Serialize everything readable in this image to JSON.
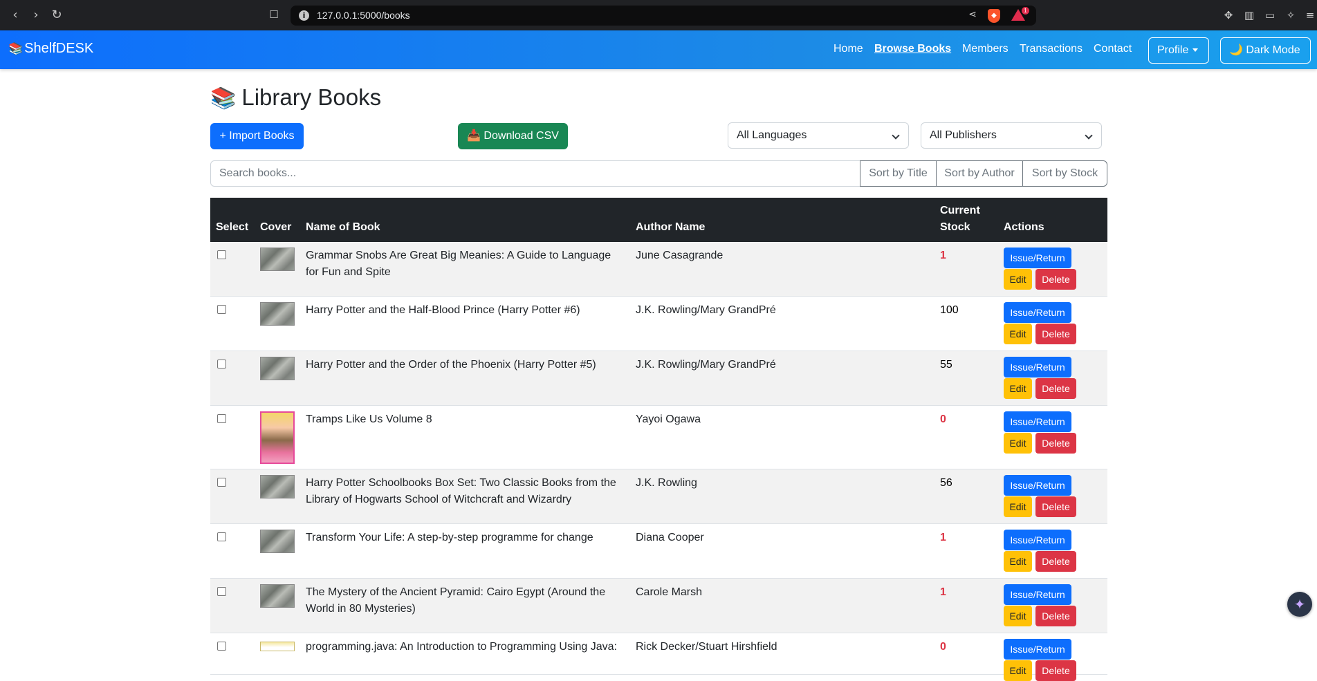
{
  "browser": {
    "url": "127.0.0.1:5000/books",
    "icons": [
      "back-icon",
      "forward-icon",
      "reload-icon",
      "bookmark-icon",
      "info-icon",
      "share-icon",
      "brave-shield-icon",
      "brave-rewards-icon",
      "extensions-icon",
      "sidebar-icon",
      "wallet-icon",
      "leo-icon",
      "menu-icon"
    ],
    "rewards_badge": "1"
  },
  "navbar": {
    "brand": "ShelfDESK",
    "brand_icon": "📚",
    "links": [
      "Home",
      "Browse Books",
      "Members",
      "Transactions",
      "Contact"
    ],
    "active_link": "Browse Books",
    "profile_label": "Profile",
    "dark_mode_label": "🌙 Dark Mode"
  },
  "page": {
    "title": "Library Books",
    "title_icon": "📚",
    "import_label": "+ Import Books",
    "download_label": "📥 Download CSV",
    "language_filter": "All Languages",
    "publisher_filter": "All Publishers",
    "search_placeholder": "Search books...",
    "sort_buttons": [
      "Sort by Title",
      "Sort by Author",
      "Sort by Stock"
    ]
  },
  "table": {
    "headers": {
      "select": "Select",
      "cover": "Cover",
      "name": "Name of Book",
      "author": "Author Name",
      "stock_line1": "Current",
      "stock_line2": "Stock",
      "actions": "Actions"
    },
    "action_labels": {
      "issue": "Issue/Return",
      "edit": "Edit",
      "delete": "Delete"
    },
    "rows": [
      {
        "title": "Grammar Snobs Are Great Big Meanies: A Guide to Language for Fun and Spite",
        "author": "June Casagrande",
        "stock": "1",
        "low": true,
        "cover": "generic"
      },
      {
        "title": "Harry Potter and the Half-Blood Prince (Harry Potter #6)",
        "author": "J.K. Rowling/Mary GrandPré",
        "stock": "100",
        "low": false,
        "cover": "generic"
      },
      {
        "title": "Harry Potter and the Order of the Phoenix (Harry Potter #5)",
        "author": "J.K. Rowling/Mary GrandPré",
        "stock": "55",
        "low": false,
        "cover": "generic"
      },
      {
        "title": "Tramps Like Us Volume 8",
        "author": "Yayoi Ogawa",
        "stock": "0",
        "low": true,
        "cover": "manga"
      },
      {
        "title": "Harry Potter Schoolbooks Box Set: Two Classic Books from the Library of Hogwarts School of Witchcraft and Wizardry",
        "author": "J.K. Rowling",
        "stock": "56",
        "low": false,
        "cover": "generic"
      },
      {
        "title": "Transform Your Life: A step-by-step programme for change",
        "author": "Diana Cooper",
        "stock": "1",
        "low": true,
        "cover": "generic"
      },
      {
        "title": "The Mystery of the Ancient Pyramid: Cairo Egypt (Around the World in 80 Mysteries)",
        "author": "Carole Marsh",
        "stock": "1",
        "low": true,
        "cover": "generic"
      },
      {
        "title": "programming.java: An Introduction to Programming Using Java:",
        "author": "Rick Decker/Stuart Hirshfield",
        "stock": "0",
        "low": true,
        "cover": "java"
      }
    ]
  },
  "colors": {
    "primary": "#0d6efd",
    "success": "#198754",
    "warning": "#ffc107",
    "danger": "#dc3545",
    "table_header": "#212529"
  },
  "assistant_icon": "leo-sparkle-icon"
}
